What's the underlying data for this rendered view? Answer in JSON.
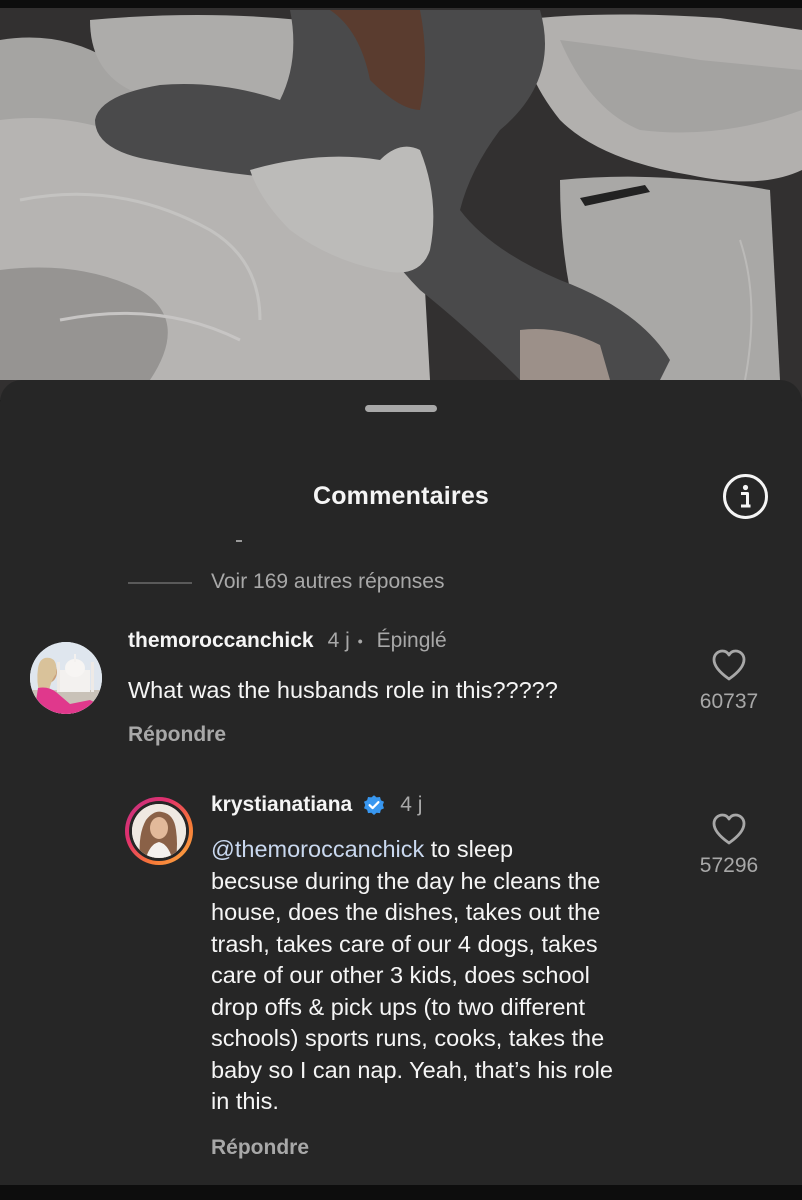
{
  "header": {
    "title": "Commentaires"
  },
  "thread": {
    "more_replies": "Voir 169 autres réponses"
  },
  "comment": {
    "username": "themoroccanchick",
    "time": "4 j",
    "separator": "•",
    "pinned": "Épinglé",
    "text": "What was the husbands role in this?????",
    "reply_label": "Répondre",
    "likes": "60737"
  },
  "reply": {
    "username": "krystianatiana",
    "verified": true,
    "time": "4 j",
    "mention": "@themoroccanchick",
    "text_lines": [
      " to sleep",
      "becsuse during the day he cleans the",
      "house, does the dishes, takes out the",
      "trash, takes care of our 4 dogs, takes",
      "care of our other 3 kids, does school",
      "drop offs & pick ups (to two different",
      "schools) sports runs, cooks, takes the",
      "baby so I can nap. Yeah, that’s his role",
      "in this."
    ],
    "reply_label": "Répondre",
    "likes": "57296"
  },
  "icons": {
    "info": "info-circle-icon",
    "like": "heart-outline-icon",
    "verified": "verified-badge-icon"
  },
  "colors": {
    "sheet_bg": "#262626",
    "verified_blue": "#3897f0",
    "mention": "#c9d8ef",
    "secondary_text": "#a8a8a8"
  }
}
